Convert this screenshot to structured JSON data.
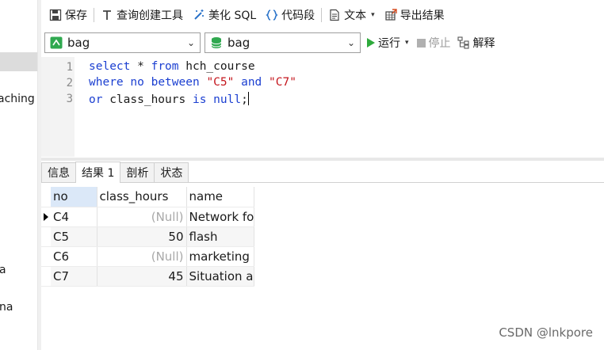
{
  "toolbar": {
    "save": "保存",
    "query_builder": "查询创建工具",
    "beautify_sql": "美化 SQL",
    "code_snippet": "代码段",
    "text": "文本",
    "export_results": "导出结果"
  },
  "selectors": {
    "connection": "bag",
    "database": "bag"
  },
  "actions": {
    "run": "运行",
    "stop": "停止",
    "explain": "解释"
  },
  "sidebar": {
    "fragment1": "aching",
    "fragment2": "a",
    "fragment3": "na"
  },
  "editor": {
    "line_numbers": [
      "1",
      "2",
      "3"
    ],
    "lines": [
      {
        "kw1": "select",
        "t1": " * ",
        "kw2": "from",
        "t2": " hch_course"
      },
      {
        "kw1": "where",
        "t1": " ",
        "kw2": "no",
        "t2": " ",
        "kw3": "between",
        "t3": " ",
        "s1": "\"C5\"",
        "t4": " ",
        "kw4": "and",
        "t5": " ",
        "s2": "\"C7\""
      },
      {
        "kw1": "or",
        "t1": " class_hours ",
        "kw2": "is",
        "t2": " ",
        "kw3": "null",
        "t3": ";"
      }
    ]
  },
  "tabs": [
    "信息",
    "结果 1",
    "剖析",
    "状态"
  ],
  "grid": {
    "columns": [
      "no",
      "class_hours",
      "name"
    ],
    "rows": [
      [
        "C4",
        "(Null)",
        "Network fo"
      ],
      [
        "C5",
        "50",
        "flash"
      ],
      [
        "C6",
        "(Null)",
        "marketing"
      ],
      [
        "C7",
        "45",
        "Situation ar"
      ]
    ]
  },
  "watermark": "CSDN @lnkpore"
}
